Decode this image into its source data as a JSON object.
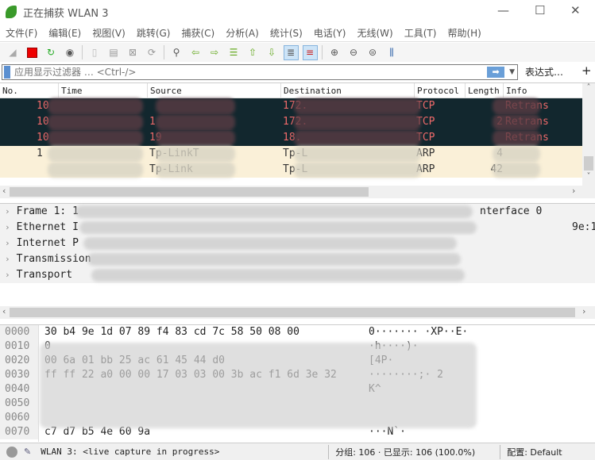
{
  "window": {
    "title": "正在捕获 WLAN 3",
    "minimize": "—",
    "maximize": "☐",
    "close": "✕"
  },
  "menu": [
    "文件(F)",
    "编辑(E)",
    "视图(V)",
    "跳转(G)",
    "捕获(C)",
    "分析(A)",
    "统计(S)",
    "电话(Y)",
    "无线(W)",
    "工具(T)",
    "帮助(H)"
  ],
  "toolbar": [
    "start-capture-icon",
    "stop-capture-icon",
    "restart-capture-icon",
    "capture-options-icon",
    "open-file-icon",
    "save-file-icon",
    "close-file-icon",
    "reload-file-icon",
    "find-packet-icon",
    "go-back-icon",
    "go-forward-icon",
    "go-to-packet-icon",
    "go-first-icon",
    "go-last-icon",
    "autoscroll-icon",
    "colorize-icon",
    "zoom-in-icon",
    "zoom-out-icon",
    "zoom-normal-icon",
    "resize-columns-icon"
  ],
  "filter": {
    "placeholder": "应用显示过滤器 … <Ctrl-/>",
    "value": "",
    "expression_label": "表达式…",
    "plus_label": "+"
  },
  "packet_list": {
    "columns": [
      "No.",
      "Time",
      "Source",
      "Destination",
      "Protocol",
      "Length",
      "Info"
    ],
    "rows": [
      {
        "no": "10",
        "time": "",
        "source": "",
        "destination": "172.",
        "protocol": "TCP",
        "length": "",
        "info": "Retrans",
        "type": "tcp"
      },
      {
        "no": "10",
        "time": "",
        "source": "1",
        "destination": "172.",
        "protocol": "TCP",
        "length": "2",
        "info": "Retrans",
        "type": "tcp"
      },
      {
        "no": "10",
        "time": "",
        "source": "19",
        "destination": "18.",
        "protocol": "TCP",
        "length": "",
        "info": "Retrans",
        "type": "tcp"
      },
      {
        "no": "1",
        "time": "",
        "source": "Tp-LinkT",
        "destination": "Tp-L",
        "protocol": "ARP",
        "length": "4",
        "info": "",
        "type": "arp"
      },
      {
        "no": "",
        "time": "",
        "source": "Tp-Link",
        "destination": "Tp-L",
        "protocol": "ARP",
        "length": "42",
        "info": "",
        "type": "arp"
      }
    ]
  },
  "detail": [
    {
      "label": "Frame 1: 1",
      "tail": "nterface 0"
    },
    {
      "label": "Ethernet I",
      "tail": "9e:1"
    },
    {
      "label": "Internet P",
      "tail": ""
    },
    {
      "label": "Transmission",
      "tail": ""
    },
    {
      "label": "Transport",
      "tail": ""
    }
  ],
  "hex": [
    {
      "off": "0000",
      "bytes": "30 b4 9e 1d 07 89 f4 83  cd 7c 58 50 08 00",
      "ascii": "0·······  ·XP··E·"
    },
    {
      "off": "0010",
      "bytes": "0",
      "ascii": "·h····)·"
    },
    {
      "off": "0020",
      "bytes": "00 6a 01 bb 25 ac 61 45  44 d0",
      "ascii": "         [4P·"
    },
    {
      "off": "0030",
      "bytes": "ff ff 22 a0 00 00 17 03  03 00 3b ac f1 6d 3e 32",
      "ascii": "········;·  2"
    },
    {
      "off": "0040",
      "bytes": "",
      "ascii": "           K^"
    },
    {
      "off": "0050",
      "bytes": "",
      "ascii": ""
    },
    {
      "off": "0060",
      "bytes": "",
      "ascii": ""
    },
    {
      "off": "0070",
      "bytes": "c7 d7 b5 4e 60 9a",
      "ascii": "···N`·"
    }
  ],
  "status": {
    "capture": "WLAN 3: <live capture in progress>",
    "packets": "分组: 106 · 已显示: 106 (100.0%)",
    "profile": "配置: Default"
  },
  "colors": {
    "tcp_row_bg": "#12272e",
    "tcp_row_fg": "#f06a6a",
    "arp_row_bg": "#faf0d8",
    "accent": "#6a9fd8"
  }
}
